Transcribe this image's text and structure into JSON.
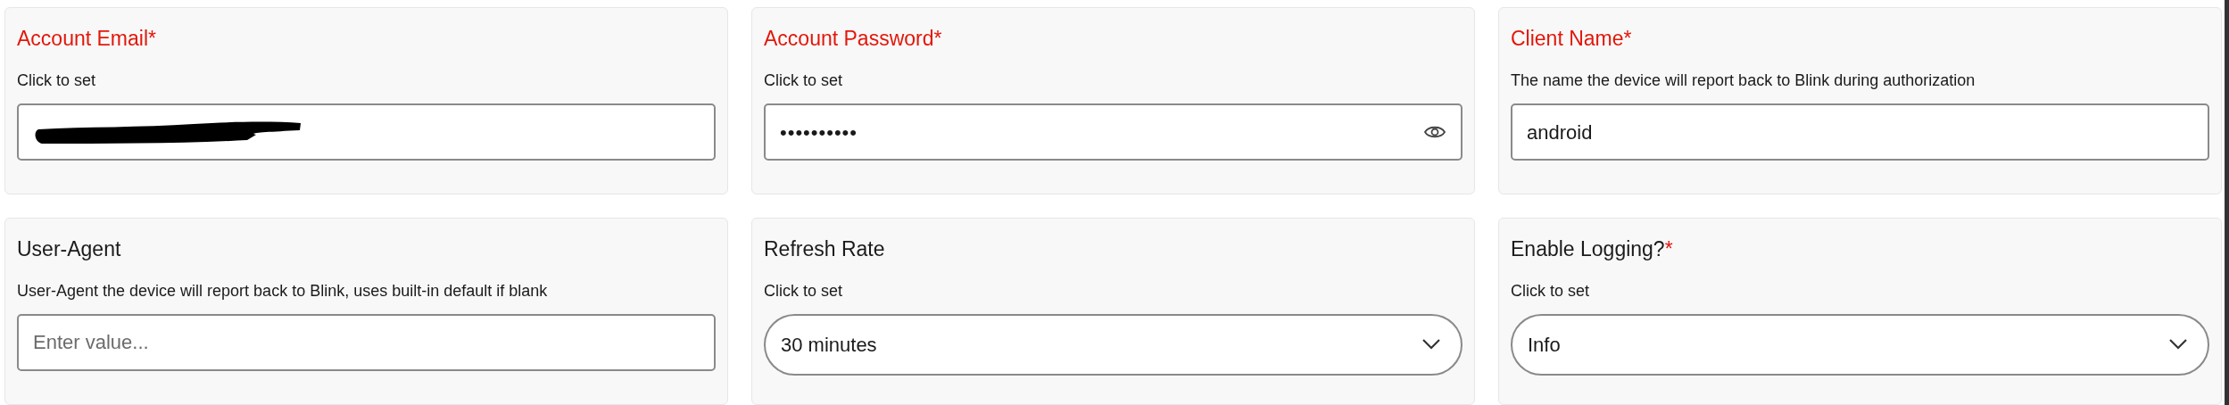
{
  "fields": [
    {
      "label": "Account Email",
      "required_mark": "*",
      "invalid": true,
      "description": "Click to set",
      "kind": "text",
      "redacted": true
    },
    {
      "label": "Account Password",
      "required_mark": "*",
      "invalid": true,
      "description": "Click to set",
      "kind": "password",
      "value": "••••••••••"
    },
    {
      "label": "Client Name",
      "required_mark": "*",
      "invalid": true,
      "description": "The name the device will report back to Blink during authorization",
      "kind": "text",
      "value": "android"
    },
    {
      "label": "User-Agent",
      "invalid": false,
      "description": "User-Agent the device will report back to Blink, uses built-in default if blank",
      "kind": "text",
      "placeholder": "Enter value..."
    },
    {
      "label": "Refresh Rate",
      "invalid": false,
      "description": "Click to set",
      "kind": "select",
      "value": "30 minutes"
    },
    {
      "label": "Enable Logging?",
      "required_mark": "*",
      "invalid": false,
      "description": "Click to set",
      "kind": "select",
      "value": "Info"
    }
  ]
}
